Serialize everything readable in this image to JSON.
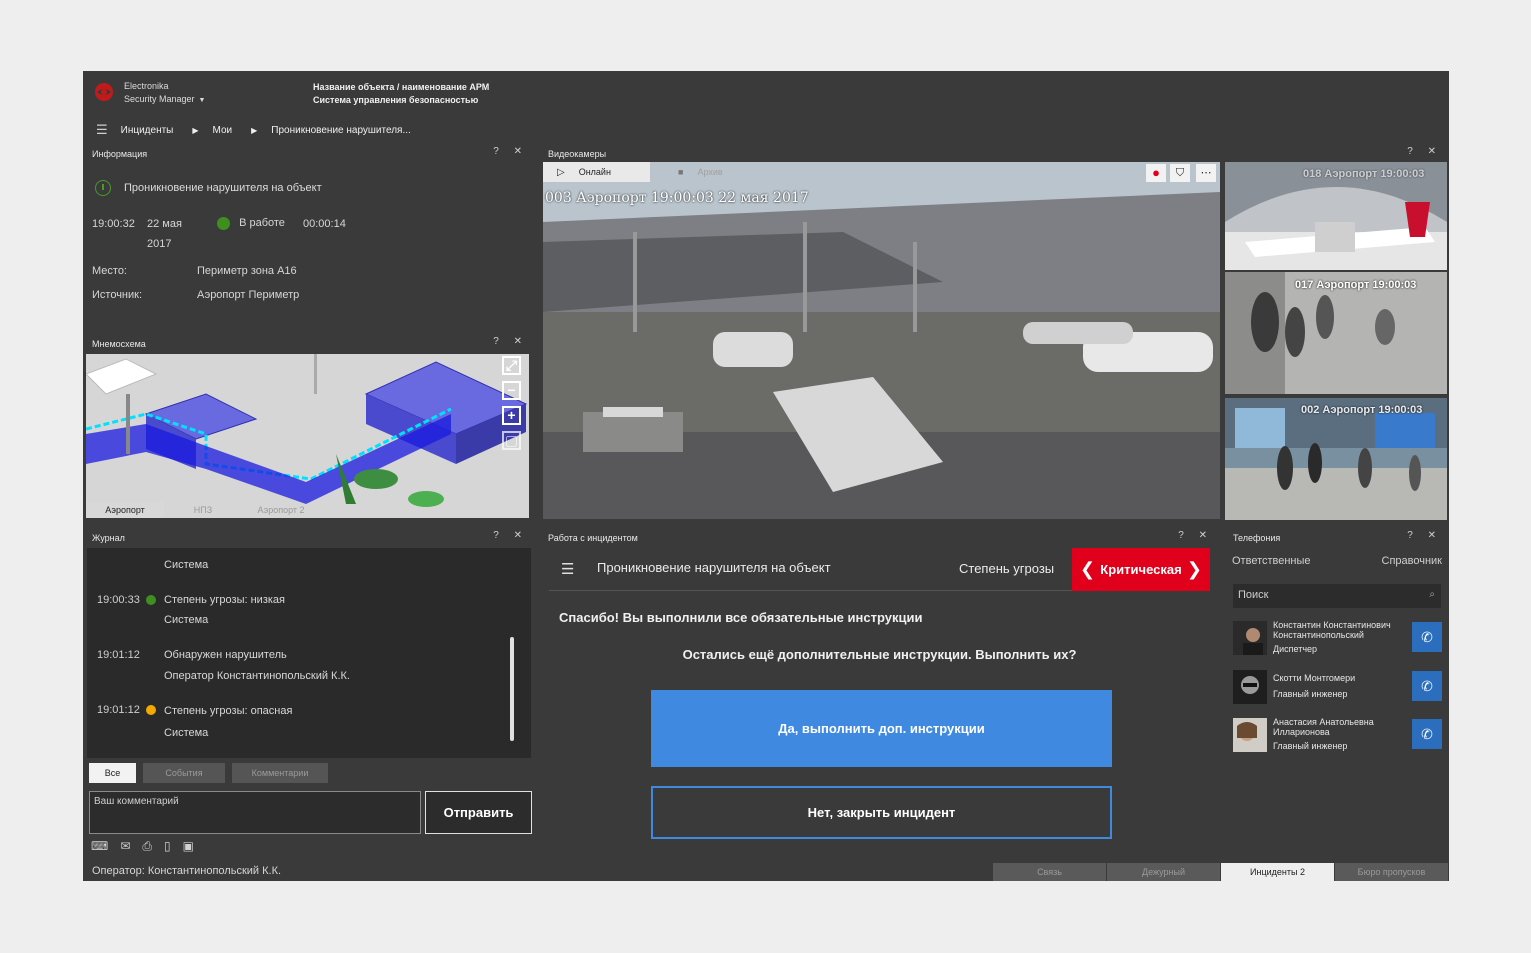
{
  "app": {
    "brand_line1": "Electronika",
    "brand_line2": "Security Manager",
    "object_title": "Название объекта / наименование АРМ",
    "object_subtitle": "Система управления безопасностью"
  },
  "breadcrumb": [
    "Инциденты",
    "Мои",
    "Проникновение нарушителя..."
  ],
  "panel_controls": "? ✕",
  "info": {
    "title": "Информация",
    "incident_name": "Проникновение нарушителя на объект",
    "time": "19:00:32",
    "date_line1": "22 мая",
    "date_line2": "2017",
    "status": "В работе",
    "status_color": "#3f8f1f",
    "duration": "00:00:14",
    "place_label": "Место:",
    "place_value": "Периметр зона А16",
    "source_label": "Источник:",
    "source_value": "Аэропорт Периметр"
  },
  "mnemo": {
    "title": "Мнемосхема",
    "tabs": [
      "Аэропорт",
      "НПЗ",
      "Аэропорт 2"
    ],
    "active_tab": "Аэропорт"
  },
  "video": {
    "title": "Видеокамеры",
    "mode_online": "Онлайн",
    "mode_archive": "Архив",
    "main_camera": "003 Аэропорт 19:00:03 22 мая 2017",
    "thumbs": [
      {
        "label": "018 Аэропорт  19:00:03"
      },
      {
        "label": "017 Аэропорт  19:00:03"
      },
      {
        "label": "002 Аэропорт  19:00:03"
      }
    ]
  },
  "journal": {
    "title": "Журнал",
    "entries": [
      {
        "time": "",
        "text": "Система",
        "dot": ""
      },
      {
        "time": "19:00:33",
        "text": "Степень угрозы: низкая",
        "dot": "#3f8f1f"
      },
      {
        "time": "",
        "text": "Система",
        "dot": ""
      },
      {
        "time": "19:01:12",
        "text": "Обнаружен нарушитель",
        "dot": ""
      },
      {
        "time": "",
        "text": "Оператор Константинопольский К.К.",
        "dot": ""
      },
      {
        "time": "19:01:12",
        "text": "Степень угрозы: опасная",
        "dot": "#f2a900"
      },
      {
        "time": "",
        "text": "Система",
        "dot": ""
      }
    ],
    "filters": [
      "Все",
      "События",
      "Комментарии"
    ],
    "comment_placeholder": "Ваш комментарий",
    "send_label": "Отправить"
  },
  "incident": {
    "title": "Работа с инцидентом",
    "name": "Проникновение нарушителя на объект",
    "threat_label": "Степень угрозы",
    "threat_level": "Критическая",
    "threat_color": "#e0001b",
    "message1": "Спасибо! Вы выполнили все обязательные инструкции",
    "message2": "Остались ещё дополнительные инструкции. Выполнить их?",
    "yes_label": "Да, выполнить доп. инструкции",
    "no_label": "Нет, закрыть инцидент"
  },
  "phone": {
    "title": "Телефония",
    "tab_responsible": "Ответственные",
    "tab_directory": "Справочник",
    "search_placeholder": "Поиск",
    "contacts": [
      {
        "name": "Константин Константинович Константинопольский",
        "role": "Диспетчер"
      },
      {
        "name": "Скотти Монтгомери",
        "role": "Главный инженер"
      },
      {
        "name": "Анастасия Анатольевна Илларионова",
        "role": "Главный инженер"
      }
    ]
  },
  "statusbar": {
    "operator": "Оператор: Константинопольский К.К.",
    "tabs": [
      "Связь",
      "Дежурный",
      "Инциденты 2",
      "Бюро пропусков"
    ],
    "active_tab": "Инциденты 2"
  }
}
